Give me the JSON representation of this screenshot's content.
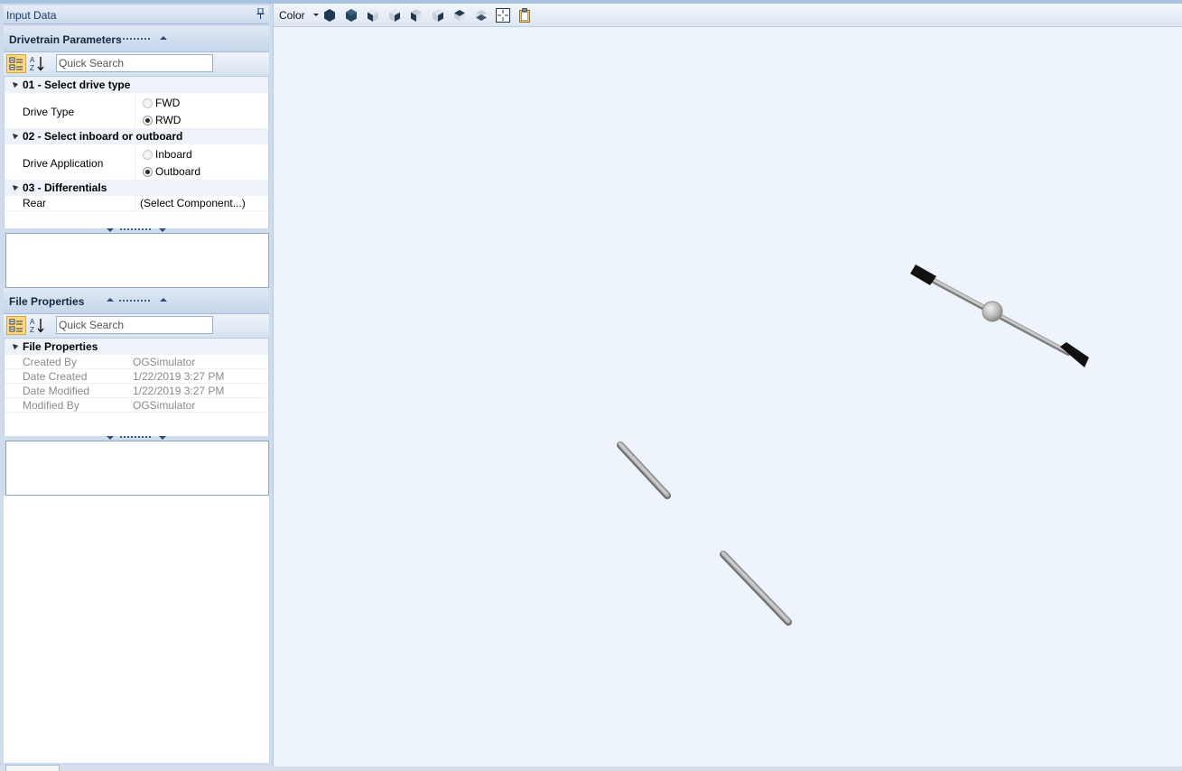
{
  "dock": {
    "title": "Input Data"
  },
  "drivetrain": {
    "header": "Drivetrain Parameters",
    "search_placeholder": "Quick Search",
    "categories": [
      {
        "title": "01 - Select drive type",
        "property": "Drive Type",
        "options": [
          "FWD",
          "RWD"
        ],
        "selected": "RWD"
      },
      {
        "title": "02 - Select inboard or outboard",
        "property": "Drive Application",
        "options": [
          "Inboard",
          "Outboard"
        ],
        "selected": "Outboard"
      },
      {
        "title": "03 - Differentials",
        "rows": [
          {
            "name": "Rear",
            "value": "(Select Component...)"
          }
        ]
      }
    ]
  },
  "file_properties": {
    "header": "File Properties",
    "search_placeholder": "Quick Search",
    "category": "File Properties",
    "rows": [
      {
        "name": "Created By",
        "value": "OGSimulator"
      },
      {
        "name": "Date Created",
        "value": "1/22/2019 3:27 PM"
      },
      {
        "name": "Date Modified",
        "value": "1/22/2019 3:27 PM"
      },
      {
        "name": "Modified By",
        "value": "OGSimulator"
      }
    ]
  },
  "viewport": {
    "color_label": "Color",
    "toolbar_icons": [
      "view-cube-icon",
      "view-cube-icon",
      "view-front-icon",
      "view-back-icon",
      "view-left-icon",
      "view-right-icon",
      "view-top-icon",
      "view-bottom-icon",
      "fit-view-icon",
      "clipboard-icon"
    ],
    "background": "#eef4fc"
  },
  "colors": {
    "accent": "#fbd985",
    "shaft": "#a9a9a9",
    "tire": "#111111"
  }
}
